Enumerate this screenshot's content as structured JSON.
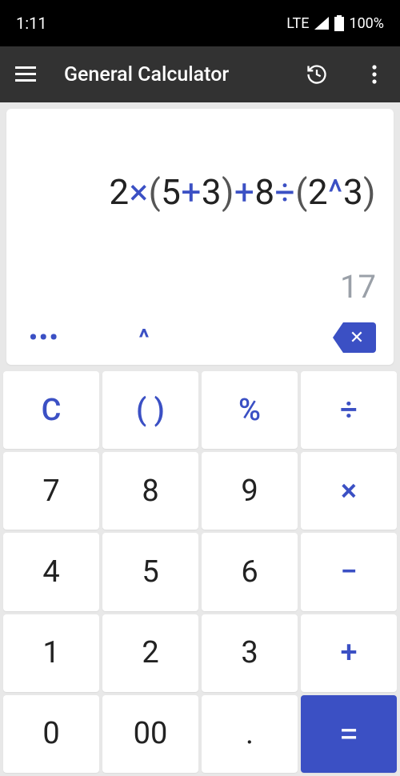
{
  "status": {
    "time": "1:11",
    "network": "LTE",
    "battery": "100%"
  },
  "appbar": {
    "title": "General Calculator"
  },
  "display": {
    "expression_tokens": [
      {
        "t": "num",
        "v": "2"
      },
      {
        "t": "op",
        "v": "×"
      },
      {
        "t": "paren",
        "v": "("
      },
      {
        "t": "num",
        "v": "5"
      },
      {
        "t": "op",
        "v": "+"
      },
      {
        "t": "num",
        "v": "3"
      },
      {
        "t": "paren",
        "v": ")"
      },
      {
        "t": "op",
        "v": "+"
      },
      {
        "t": "num",
        "v": "8"
      },
      {
        "t": "op",
        "v": "÷"
      },
      {
        "t": "paren",
        "v": "("
      },
      {
        "t": "num",
        "v": "2"
      },
      {
        "t": "op",
        "v": "^"
      },
      {
        "t": "num",
        "v": "3"
      },
      {
        "t": "paren",
        "v": ")"
      }
    ],
    "result": "17",
    "more_label": "•••",
    "caret_label": "^",
    "backspace_label": "✕"
  },
  "keys": {
    "clear": "C",
    "paren": "( )",
    "percent": "%",
    "divide": "÷",
    "seven": "7",
    "eight": "8",
    "nine": "9",
    "multiply": "×",
    "four": "4",
    "five": "5",
    "six": "6",
    "minus": "−",
    "one": "1",
    "two": "2",
    "three": "3",
    "plus": "+",
    "zero": "0",
    "dzero": "00",
    "dot": ".",
    "equals": "="
  }
}
